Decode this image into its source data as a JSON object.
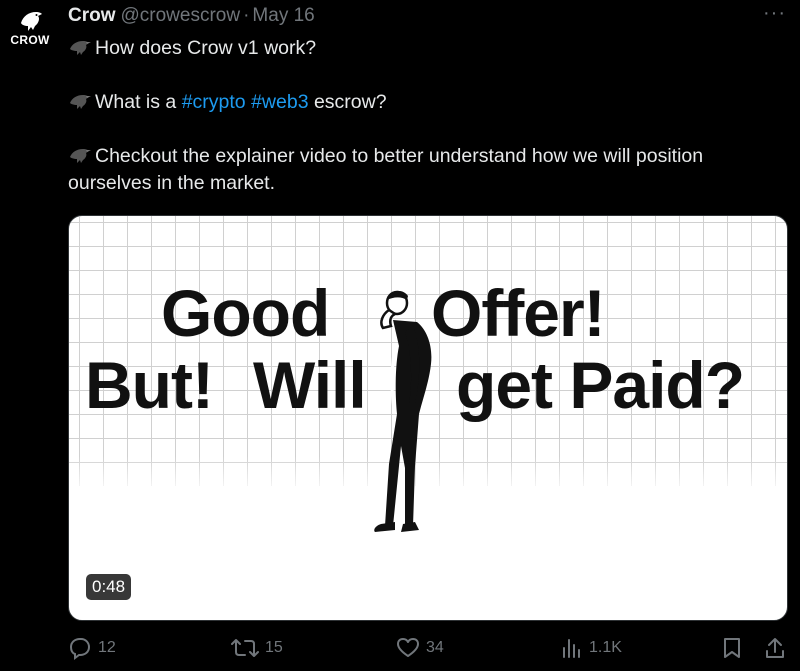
{
  "author": {
    "avatar_label": "CROW",
    "name": "Crow",
    "handle": "@crowescrow",
    "separator": "·",
    "date": "May 16"
  },
  "more_label": "···",
  "tweet": {
    "line1": "How does Crow v1 work?",
    "line2_prefix": "What is a ",
    "hashtag1": "#crypto",
    "hashtag2": "#web3",
    "line2_suffix": " escrow?",
    "line3": "Checkout the explainer video to better understand how we will position ourselves in the market."
  },
  "media": {
    "video_text": {
      "word1": "Good",
      "word2": "Offer!",
      "word3": "But!",
      "word4": "Will",
      "word5": "get Paid?"
    },
    "duration": "0:48"
  },
  "actions": {
    "replies": "12",
    "reposts": "15",
    "likes": "34",
    "views": "1.1K"
  },
  "colors": {
    "background": "#000000",
    "text": "#e7e9ea",
    "muted": "#71767b",
    "hashtag": "#1d9bf0"
  },
  "icons": [
    "crow-logo-icon",
    "crow-emoji-icon",
    "more-icon",
    "reply-icon",
    "repost-icon",
    "like-icon",
    "views-icon",
    "bookmark-icon",
    "share-icon"
  ]
}
